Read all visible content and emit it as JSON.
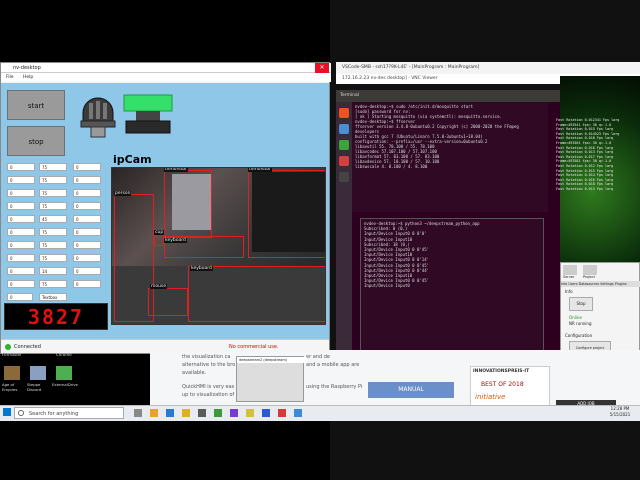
{
  "app": {
    "title": "nv-desktop",
    "menu": [
      "File",
      "Help"
    ],
    "start_label": "start",
    "stop_label": "stop",
    "ipcam_label": "ipCam",
    "counter": "3827",
    "left_fields": [
      [
        "0",
        "75",
        "0"
      ],
      [
        "0",
        "75",
        "0"
      ],
      [
        "0",
        "75",
        "0"
      ],
      [
        "0",
        "75",
        "0"
      ],
      [
        "0",
        "45",
        "0"
      ],
      [
        "0",
        "75",
        "0"
      ],
      [
        "0",
        "75",
        "0"
      ],
      [
        "0",
        "75",
        "0"
      ],
      [
        "0",
        "14",
        "0"
      ],
      [
        "0",
        "75",
        "0"
      ]
    ],
    "field_text": "Textbox",
    "status_connected": "Connected",
    "status_notice": "No commercial use."
  },
  "detections": [
    "tvmonitor",
    "tvmonitor",
    "person",
    "cup",
    "keyboard",
    "keyboard",
    "mouse"
  ],
  "vs": {
    "title": "VSCode-SMB - ssh17?9K-L4E' - [MainProgram : MainProgram]",
    "address": "172.16.2.23 nv-des desktop] - VNC Viewer"
  },
  "terminal": {
    "header": "Terminal",
    "lines": [
      "nvdev-desktop:~$ sudo /etc/init.d/mosquitto start",
      "[sudo] password for nv:",
      "[ ok ] Starting mosquitto (via systemctl): mosquitto.service.",
      "nvdev-desktop:~$ ffserver",
      "ffserver version 3.4.8-0ubuntu0.2 Copyright (c) 2000-2020 the FFmpeg developers",
      "  built with gcc 7 (Ubuntu/Linaro 7.5.0-3ubuntu1~18.04)",
      "  configuration: --prefix=/usr --extra-version=0ubuntu0.2",
      "  libavutil      55. 78.100 / 55. 78.100",
      "  libavcodec     57.107.100 / 57.107.100",
      "  libavformat    57. 83.100 / 57. 83.100",
      "  libavdevice    57. 10.100 / 57. 10.100",
      "  libswscale      4.  8.100 /  4.  8.100"
    ],
    "lines2": [
      "nvdev-desktop:~$ python3 ~/deepstream_python_app",
      "Subscribed: 0 (0,)",
      "Input/Device Input0 0 0'0'",
      "Input/Device Input10",
      "Subscribed: 18 (0,)",
      "Input/Device Input0 0 0'45'",
      "Input/Device Input10",
      "Input/Device Input0 0 0'14'",
      "Input/Device Input0 0 0'45'",
      "Input/Device Input0 0 0'44'",
      "Input/Device Input10",
      "Input/Device Input0 0 0'45'",
      "Input/Device Input0"
    ]
  },
  "log": [
    "Fast Rotation 0.012341 Fps larg",
    "Frame=493541 fps= 30 q=-1.0",
    "Fast Rotation 0.015 Fps larg",
    "Fast Rotation 0.014523 Fps larg",
    "Fast Rotation 0.018 Fps larg",
    "Frame=493561 fps= 30 q=-1.0",
    "Fast Rotation 0.016 Fps larg",
    "Fast Rotation 0.013 Fps larg",
    "Fast Rotation 0.017 Fps larg",
    "Frame=493581 fps= 30 q=-1.0",
    "Fast Rotation 0.012 Fps larg",
    "Fast Rotation 0.015 Fps larg",
    "Fast Rotation 0.014 Fps larg",
    "Fast Rotation 0.016 Fps larg",
    "Fast Rotation 0.018 Fps larg",
    "Fast Rotation 0.013 Fps larg"
  ],
  "panel": {
    "tabs": [
      "Info",
      "Users",
      "Datasources",
      "Settings",
      "Plugins"
    ],
    "info": "Info",
    "stop": "Stop",
    "online": "Online",
    "running": "NR running",
    "configuration": "Configuration",
    "configure_project": "Configure project",
    "server_label": "Server",
    "project_label": "Project"
  },
  "web": {
    "line1": "the visualization ca",
    "line2": "alternative to the bro",
    "line3": "available.",
    "line4": "QuickHMI is very eas",
    "line5": "up to visualization of",
    "side1": "er and de",
    "side2": "and a mobile app are",
    "side3": "using the Raspberry Pi",
    "manual": "MANUAL",
    "innov_title": "INNOVATIONSPREIS-IT",
    "innov_best": "BEST OF 2018",
    "innov_tag": "initiative",
    "footer_btn": "ADD JOB"
  },
  "taskbar": {
    "search": "Search for anything",
    "popup": "deepstream2 (deepstream)",
    "time": "12:28 PM",
    "date": "5/15/2021"
  },
  "desktop_icons": [
    "Formatter",
    "Chrome",
    "Age of Empires",
    "Steppe Discord",
    "ExternalDrive"
  ],
  "colors": {
    "hmi_bg": "#8fc7e8",
    "counter_red": "#e01010",
    "terminal_bg": "#300a24",
    "green_led": "#34e06a"
  }
}
